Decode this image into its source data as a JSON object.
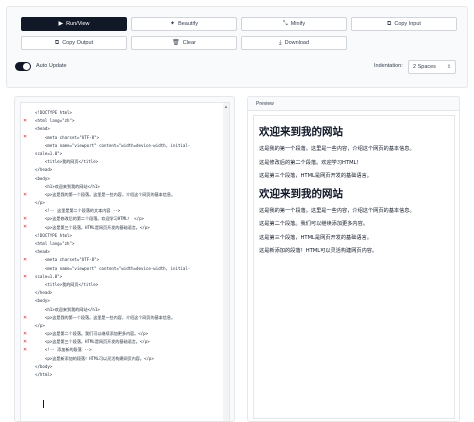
{
  "toolbar": {
    "buttons": [
      {
        "label": "Run/View",
        "icon": "▶"
      },
      {
        "label": "Beautify",
        "icon": "✦"
      },
      {
        "label": "Minify",
        "icon": "⤡"
      },
      {
        "label": "Copy Input",
        "icon": "⧉"
      },
      {
        "label": "Copy Output",
        "icon": "⧉"
      },
      {
        "label": "Clear",
        "icon": "🗑"
      },
      {
        "label": "Download",
        "icon": "⤓"
      }
    ],
    "auto_update_label": "Auto Update",
    "indentation_label": "Indentation:",
    "indentation_value": "2 Spaces"
  },
  "editor": {
    "lines": [
      "<!DOCTYPE html>",
      "<html lang=\"zh\">",
      "<head>",
      "    <meta charset=\"UTF-8\">",
      "    <meta name=\"viewport\" content=\"width=device-width, initial-",
      "scale=1.0\">",
      "    <title>我的网页</title>",
      "</head>",
      "<body>",
      "    <h1>欢迎来到我的网站</h1>",
      "    <p>这是我的第一个段落。这里是一些内容，介绍这个网页的基本信息。",
      "</p>",
      "    <!-- 这里是第二个段落的文本内容 -->",
      "    <p>这是修改后的第二个段落。欢迎学习HTML！ </p>",
      "    <p>这是第三个段落，HTML是网页开发的基础语言。</p>",
      "<!DOCTYPE html>",
      "<html lang=\"zh\">",
      "<head>",
      "    <meta charset=\"UTF-8\">",
      "    <meta name=\"viewport\" content=\"width=device-width, initial-",
      "scale=1.0\">",
      "    <title>我的网页</title>",
      "</head>",
      "<body>",
      "    <h1>欢迎来到我的网站</h1>",
      "    <p>这是我的第一个段落。这里是一些内容，介绍这个网页的基本信息。",
      "</p>",
      "    <p>这是第二个段落。我们可以继续添加更多内容。</p>",
      "    <p>这是第三个段落，HTML是网页开发的基础语言。</p>",
      "    <!-- 添加新的段落 -->",
      "    <p>这是新添加的段落！HTML可以灵活构建网页内容。</p>",
      "</body>",
      "</html>",
      ""
    ],
    "error_lines": [
      2,
      4,
      11,
      14,
      15,
      19,
      21,
      26,
      28,
      29,
      30
    ]
  },
  "preview": {
    "label": "Preview",
    "blocks": [
      {
        "type": "h1",
        "text": "欢迎来到我的网站"
      },
      {
        "type": "p",
        "text": "这是我的第一个段落。这里是一些内容，介绍这个网页的基本信息。"
      },
      {
        "type": "p",
        "text": "这是修改后的第二个段落。欢迎学习HTML！"
      },
      {
        "type": "p",
        "text": "这是第三个段落，HTML是网页开发的基础语言。"
      },
      {
        "type": "h1",
        "text": "欢迎来到我的网站"
      },
      {
        "type": "p",
        "text": "这是我的第一个段落。这里是一些内容，介绍这个网页的基本信息。"
      },
      {
        "type": "p",
        "text": "这是第二个段落。我们可以继续添加更多内容。"
      },
      {
        "type": "p",
        "text": "这是第三个段落，HTML是网页开发的基础语言。"
      },
      {
        "type": "p",
        "text": "这是新添加的段落！HTML可以灵活构建网页内容。"
      }
    ]
  }
}
